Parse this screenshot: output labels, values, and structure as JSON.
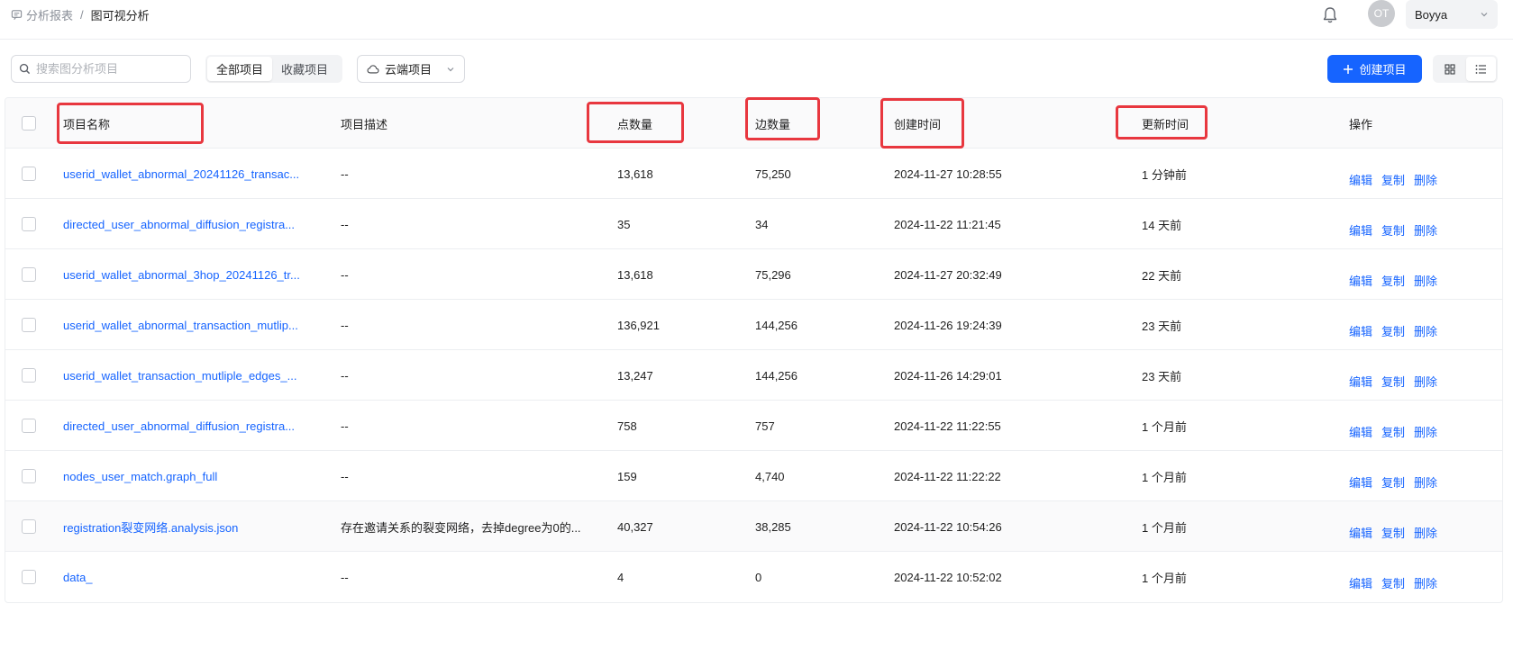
{
  "header": {
    "breadcrumb_parent": "分析报表",
    "breadcrumb_sep": "/",
    "breadcrumb_current": "图可视分析",
    "avatar_initials": "OT",
    "user_name": "Boyya"
  },
  "toolbar": {
    "search_placeholder": "搜索图分析项目",
    "tabs": [
      {
        "label": "全部项目",
        "active": true
      },
      {
        "label": "收藏项目",
        "active": false
      }
    ],
    "source_label": "云端项目",
    "create_label": "创建项目",
    "accent": "#1664ff"
  },
  "table": {
    "columns": {
      "name": "项目名称",
      "desc": "项目描述",
      "nodes": "点数量",
      "edges": "边数量",
      "created": "创建时间",
      "updated": "更新时间",
      "ops": "操作"
    },
    "actions": {
      "edit": "编辑",
      "copy": "复制",
      "delete": "删除"
    },
    "rows": [
      {
        "name": "userid_wallet_abnormal_20241126_transac...",
        "desc": "--",
        "nodes": "13,618",
        "edges": "75,250",
        "created": "2024-11-27 10:28:55",
        "updated": "1 分钟前"
      },
      {
        "name": "directed_user_abnormal_diffusion_registra...",
        "desc": "--",
        "nodes": "35",
        "edges": "34",
        "created": "2024-11-22 11:21:45",
        "updated": "14 天前"
      },
      {
        "name": "userid_wallet_abnormal_3hop_20241126_tr...",
        "desc": "--",
        "nodes": "13,618",
        "edges": "75,296",
        "created": "2024-11-27 20:32:49",
        "updated": "22 天前"
      },
      {
        "name": "userid_wallet_abnormal_transaction_mutlip...",
        "desc": "--",
        "nodes": "136,921",
        "edges": "144,256",
        "created": "2024-11-26 19:24:39",
        "updated": "23 天前"
      },
      {
        "name": "userid_wallet_transaction_mutliple_edges_...",
        "desc": "--",
        "nodes": "13,247",
        "edges": "144,256",
        "created": "2024-11-26 14:29:01",
        "updated": "23 天前"
      },
      {
        "name": "directed_user_abnormal_diffusion_registra...",
        "desc": "--",
        "nodes": "758",
        "edges": "757",
        "created": "2024-11-22 11:22:55",
        "updated": "1 个月前"
      },
      {
        "name": "nodes_user_match.graph_full",
        "desc": "--",
        "nodes": "159",
        "edges": "4,740",
        "created": "2024-11-22 11:22:22",
        "updated": "1 个月前"
      },
      {
        "name": "registration裂变网络.analysis.json",
        "desc": "存在邀请关系的裂变网络，去掉degree为0的...",
        "nodes": "40,327",
        "edges": "38,285",
        "created": "2024-11-22 10:54:26",
        "updated": "1 个月前"
      },
      {
        "name": "data_",
        "desc": "--",
        "nodes": "4",
        "edges": "0",
        "created": "2024-11-22 10:52:02",
        "updated": "1 个月前"
      }
    ]
  },
  "highlight_color": "#e8373f"
}
